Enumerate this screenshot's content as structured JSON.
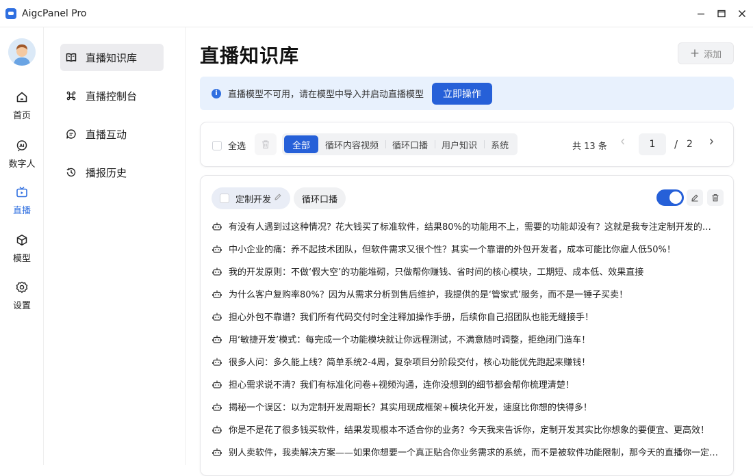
{
  "window": {
    "title": "AigcPanel Pro"
  },
  "rail": [
    {
      "label": "首页",
      "icon": "home-icon"
    },
    {
      "label": "数字人",
      "icon": "ai-icon"
    },
    {
      "label": "直播",
      "icon": "tv-icon",
      "active": true
    },
    {
      "label": "模型",
      "icon": "cube-icon"
    },
    {
      "label": "设置",
      "icon": "gear-icon"
    }
  ],
  "subnav": [
    {
      "label": "直播知识库",
      "icon": "book-icon",
      "active": true
    },
    {
      "label": "直播控制台",
      "icon": "command-icon"
    },
    {
      "label": "直播互动",
      "icon": "chat-icon"
    },
    {
      "label": "播报历史",
      "icon": "history-icon"
    }
  ],
  "page": {
    "title": "直播知识库",
    "add_label": "添加"
  },
  "alert": {
    "message": "直播模型不可用，请在模型中导入并启动直播模型",
    "action": "立即操作"
  },
  "filter": {
    "select_all": "全选",
    "tabs": [
      "全部",
      "循环内容视频",
      "循环口播",
      "用户知识",
      "系统"
    ],
    "active_tab": "全部",
    "total": "共 13 条",
    "page": "1",
    "slash": "/",
    "pages": "2"
  },
  "card": {
    "tag": "定制开发",
    "type": "循环口播",
    "enabled": true,
    "items": [
      "有没有人遇到过这种情况？花大钱买了标准软件，结果80%的功能用不上，需要的功能却没有？这就是我专注定制开发的原因！",
      "中小企业的痛：养不起技术团队，但软件需求又很个性？其实一个靠谱的外包开发者，成本可能比你雇人低50%！",
      "我的开发原则：不做‘假大空’的功能堆砌，只做帮你赚钱、省时间的核心模块，工期短、成本低、效果直接",
      "为什么客户复购率80%？因为从需求分析到售后维护，我提供的是‘管家式’服务，而不是一锤子买卖！",
      "担心外包不靠谱？我们所有代码交付时全注释加操作手册，后续你自己招团队也能无缝接手！",
      "用‘敏捷开发’模式：每完成一个功能模块就让你远程测试，不满意随时调整，拒绝闭门造车！",
      "很多人问：多久能上线？简单系统2-4周，复杂项目分阶段交付，核心功能优先跑起来赚钱！",
      "担心需求说不清？我们有标准化问卷+视频沟通，连你没想到的细节都会帮你梳理清楚！",
      "揭秘一个误区：以为定制开发周期长？其实用现成框架+模块化开发，速度比你想的快得多！",
      "你是不是花了很多钱买软件，结果发现根本不适合你的业务？今天我来告诉你，定制开发其实比你想象的要便宜、更高效！",
      "别人卖软件，我卖解决方案——如果你想要一个真正贴合你业务需求的系统，而不是被软件功能限制，那今天的直播你一定要看完！"
    ]
  },
  "colors": {
    "accent": "#2660d8",
    "alert_bg": "#e8f1fd",
    "active_nav_bg": "#ececef"
  }
}
